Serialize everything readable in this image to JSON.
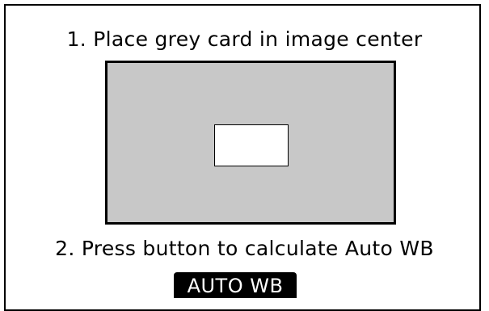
{
  "dialog": {
    "step1_text": "1. Place grey card in image center",
    "step2_text": "2. Press button to calculate Auto WB"
  },
  "preview": {
    "frame_fill": "#c8c8c8",
    "target_fill": "#ffffff"
  },
  "action": {
    "button_label": "AUTO WB"
  }
}
